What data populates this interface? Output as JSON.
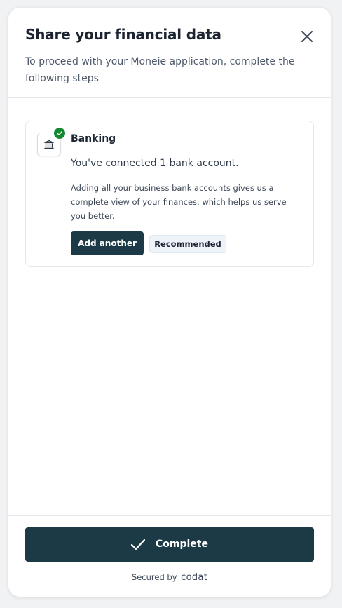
{
  "modal": {
    "title": "Share your financial data",
    "subtitle": "To proceed with your Moneie application, complete the following steps"
  },
  "icons": {
    "close": "close-icon",
    "bank": "bank-icon",
    "status": "check-circle-icon",
    "complete": "check-icon"
  },
  "card": {
    "title": "Banking",
    "status": "You've connected 1 bank account.",
    "description": "Adding all your business bank accounts gives us a complete view of your finances, which helps us serve you better.",
    "add_button_label": "Add another",
    "badge_label": "Recommended"
  },
  "footer": {
    "complete_label": "Complete",
    "secured_prefix": "Secured by",
    "brand": "codat"
  },
  "colors": {
    "primary": "#1b3a46",
    "success": "#118a2f",
    "text_dark": "#1c2431",
    "text_muted": "#4e5a6b",
    "border": "#e4e7eb",
    "badge_bg": "#eef3fa"
  }
}
